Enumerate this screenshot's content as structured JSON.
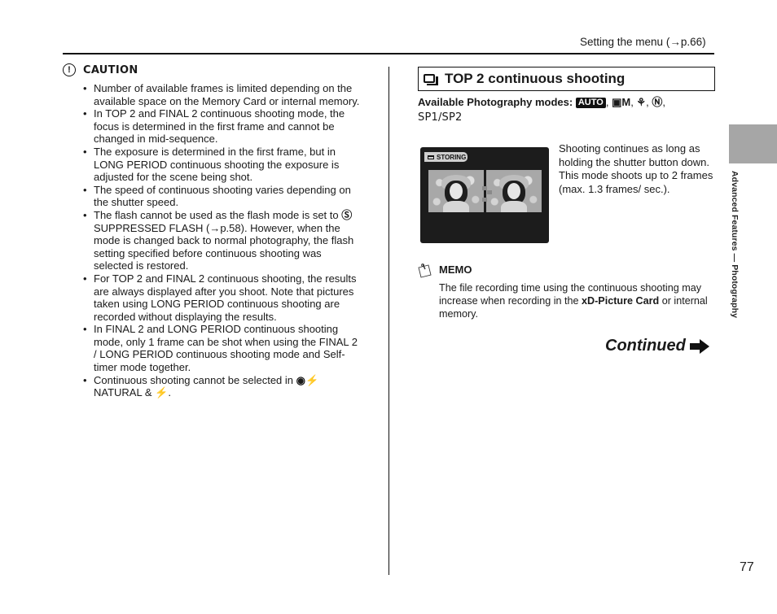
{
  "header": {
    "reference": "Setting the menu (→p.66)"
  },
  "caution": {
    "icon": "exclamation-circle-icon",
    "title": "CAUTION",
    "items": [
      "Number of available frames is limited depending on the available space on the Memory Card or internal memory.",
      "In TOP 2 and FINAL 2 continuous shooting mode, the focus is determined in the first frame and cannot be changed in mid-sequence.",
      "The exposure is determined in the first frame, but in LONG PERIOD continuous shooting the exposure is adjusted for the scene being shot.",
      "The speed of continuous shooting varies depending on the shutter speed."
    ],
    "flash_item": {
      "before": "The flash cannot be used as the flash mode is set to ",
      "glyph": "Ⓢ",
      "after": " SUPPRESSED FLASH (→p.58). However, when the mode is changed back to normal photography, the flash setting specified before continuous shooting was selected is restored."
    },
    "items_after": [
      "For TOP 2 and FINAL 2 continuous shooting, the results are always displayed after you shoot. Note that pictures taken using LONG PERIOD continuous shooting are recorded without displaying the results.",
      "In FINAL 2 and LONG PERIOD continuous shooting mode, only 1 frame can be shot when using the FINAL 2 / LONG PERIOD continuous shooting mode and Self-timer mode together."
    ],
    "natural_item": {
      "before": "Continuous shooting cannot be selected in ",
      "glyph1": "◉⚡",
      "middle": " NATURAL & ",
      "glyph2": "⚡",
      "after": "."
    }
  },
  "section": {
    "icon": "continuous-shooting-icon",
    "title": "TOP 2 continuous shooting",
    "modes_label": "Available Photography modes:",
    "mode_auto": "AUTO",
    "mode_manual": "▣M",
    "mode_scene": "⚘",
    "mode_natural": "Ⓝ",
    "sep": ", ",
    "mode_sp": "SP1/SP2"
  },
  "lcd": {
    "status": "STORING"
  },
  "description": "Shooting continues as long as holding the shutter button down. This mode shoots up to 2 frames (max. 1.3 frames/ sec.).",
  "memo": {
    "icon": "memo-note-icon",
    "title": "MEMO",
    "text_before": "The file recording time using the continuous shooting may increase when recording in the ",
    "text_bold": "xD-Picture Card",
    "text_after": " or internal memory."
  },
  "continued": {
    "label": "Continued",
    "icon": "arrow-right-icon"
  },
  "side": {
    "label": "Advanced Features — Photography"
  },
  "page_number": "77"
}
